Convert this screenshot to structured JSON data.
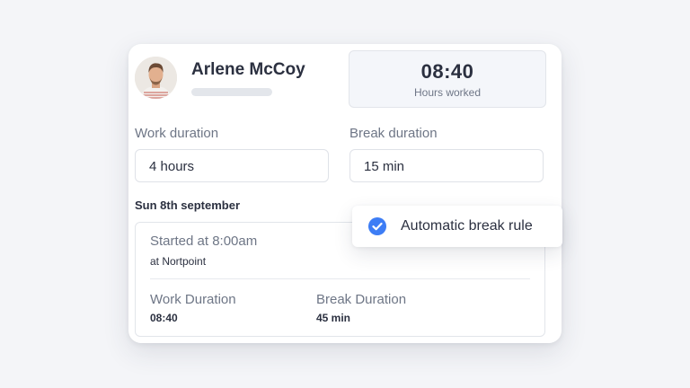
{
  "user": {
    "name": "Arlene McCoy"
  },
  "summary": {
    "hours_value": "08:40",
    "hours_label": "Hours worked"
  },
  "fields": {
    "work_label": "Work duration",
    "work_value": "4 hours",
    "break_label": "Break duration",
    "break_value": "15 min"
  },
  "entry": {
    "date": "Sun 8th september",
    "started": "Started at 8:00am",
    "location": "at Nortpoint",
    "work_duration_label": "Work Duration",
    "work_duration_value": "08:40",
    "break_duration_label": "Break Duration",
    "break_duration_value": "45 min"
  },
  "popup": {
    "label": "Automatic break rule",
    "checked": true,
    "accent_color": "#3d7df5"
  },
  "icons": {
    "avatar": "user-avatar-photo",
    "check": "check-circle-icon"
  }
}
